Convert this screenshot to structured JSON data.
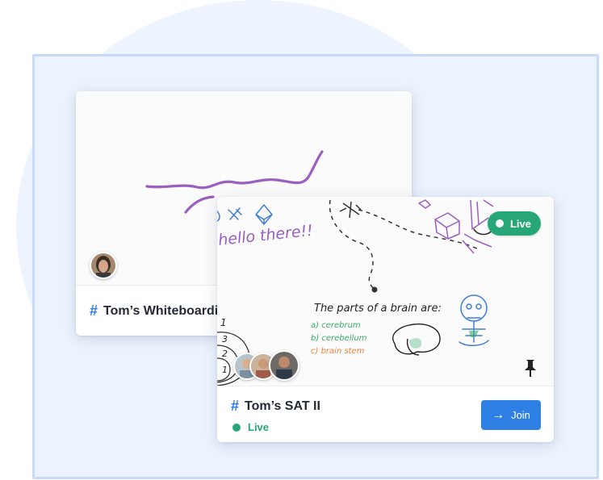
{
  "cards": [
    {
      "title_hash": "#",
      "title": "Tom’s Whiteboarding",
      "avatar": "user-avatar-woman"
    },
    {
      "title_hash": "#",
      "title": "Tom’s SAT II",
      "status": "Live",
      "badge": "Live",
      "join_label": "Join",
      "join_icon": "arrow-right-icon",
      "pin_icon": "pin-icon",
      "participants": [
        "avatar-1",
        "avatar-2",
        "avatar-3"
      ],
      "drawing": {
        "greeting": "hello there!!",
        "heading": "The parts of a brain are:",
        "items": [
          "a) cerebrum",
          "b) cerebellum",
          "c) brain stem"
        ],
        "count_labels": [
          "3",
          "2",
          "1",
          "1"
        ]
      }
    }
  ],
  "colors": {
    "accent": "#2f80e4",
    "live": "#27a777",
    "ink_purple": "#9b5fc0",
    "ink_green": "#3aa86b",
    "ink_orange": "#e8843a",
    "ink_blue": "#3e7fd6"
  }
}
